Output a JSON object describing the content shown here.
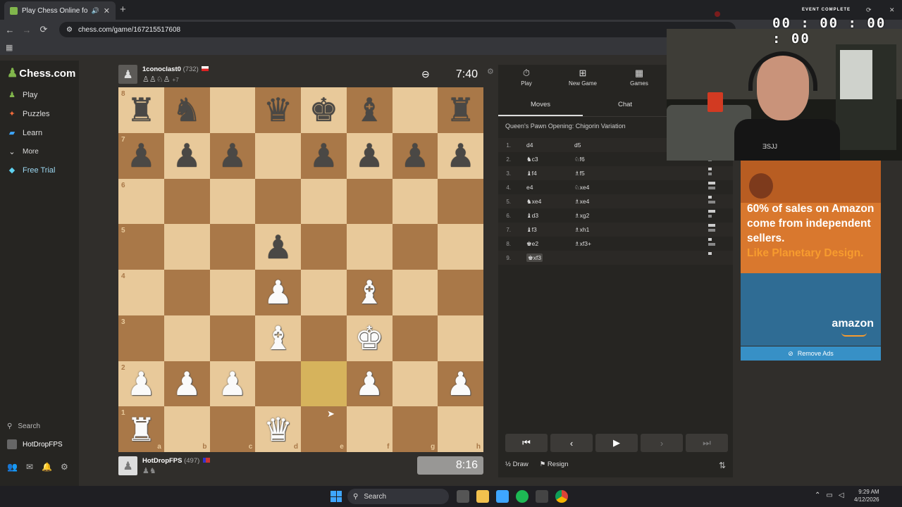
{
  "browser": {
    "tab_title": "Play Chess Online for FREE",
    "tab_close": "✕",
    "tab_audio": "🔊",
    "new_tab": "+",
    "url": "chess.com/game/167215517608",
    "back": "←",
    "forward": "→",
    "reload": "⟳",
    "apps": "▦"
  },
  "sidebar": {
    "logo": "Chess.com",
    "items": [
      {
        "label": "Play",
        "icon": "play-icon"
      },
      {
        "label": "Puzzles",
        "icon": "puzzle-icon"
      },
      {
        "label": "Learn",
        "icon": "learn-icon"
      },
      {
        "label": "More",
        "icon": "chevron-down-icon"
      },
      {
        "label": "Free Trial",
        "icon": "diamond-icon"
      }
    ],
    "search": "Search",
    "user": "HotDropFPS"
  },
  "top_player": {
    "name": "1conoclast0",
    "rating": "(732)",
    "captured": "♙♙♘♙",
    "extra": "+7",
    "clock": "7:40"
  },
  "bottom_player": {
    "name": "HotDropFPS",
    "rating": "(497)",
    "captured": "♟♞",
    "clock": "8:16"
  },
  "board": {
    "ranks": [
      "8",
      "7",
      "6",
      "5",
      "4",
      "3",
      "2",
      "1"
    ],
    "files": [
      "a",
      "b",
      "c",
      "d",
      "e",
      "f",
      "g",
      "h"
    ],
    "position": [
      [
        "r",
        "n",
        "",
        "q",
        "k",
        "b",
        "",
        "r"
      ],
      [
        "p",
        "p",
        "p",
        "",
        "p",
        "p",
        "p",
        "p"
      ],
      [
        "",
        "",
        "",
        "",
        "",
        "",
        "",
        ""
      ],
      [
        "",
        "",
        "",
        "p",
        "",
        "",
        "",
        ""
      ],
      [
        "",
        "",
        "",
        "P",
        "",
        "B",
        "",
        ""
      ],
      [
        "",
        "",
        "",
        "B",
        "",
        "K",
        "",
        ""
      ],
      [
        "P",
        "P",
        "P",
        "",
        "",
        "P",
        "",
        "P"
      ],
      [
        "R",
        "",
        "",
        "Q",
        "",
        "",
        "",
        ""
      ]
    ],
    "highlight": "e2"
  },
  "panel": {
    "tabs": [
      {
        "label": "Play",
        "icon": "stopwatch-icon"
      },
      {
        "label": "New Game",
        "icon": "plus-icon"
      },
      {
        "label": "Games",
        "icon": "board-icon"
      }
    ],
    "subtabs": [
      "Moves",
      "Chat"
    ],
    "opening": "Queen's Pawn Opening: Chigorin Variation",
    "moves": [
      {
        "n": "1.",
        "w": "d4",
        "b": "d5"
      },
      {
        "n": "2.",
        "w": "♞c3",
        "b": "♘f6"
      },
      {
        "n": "3.",
        "w": "♝f4",
        "b": "♗f5"
      },
      {
        "n": "4.",
        "w": "e4",
        "b": "♘xe4"
      },
      {
        "n": "5.",
        "w": "♞xe4",
        "b": "♗xe4"
      },
      {
        "n": "6.",
        "w": "♝d3",
        "b": "♗xg2"
      },
      {
        "n": "7.",
        "w": "♝f3",
        "b": "♗xh1"
      },
      {
        "n": "8.",
        "w": "♚e2",
        "b": "♗xf3+"
      },
      {
        "n": "9.",
        "w": "♚xf3",
        "b": ""
      }
    ],
    "draw": "Draw",
    "resign": "Resign"
  },
  "stream": {
    "event": "EVENT COMPLETE",
    "timer": "00 : 00 : 00 : 00",
    "shirt_text": "ƎSJJ"
  },
  "ad": {
    "line1": "60% of sales on Amazon come from independent sellers.",
    "line2": "Like Planetary Design.",
    "brand": "amazon",
    "remove": "Remove Ads"
  },
  "taskbar": {
    "search": "Search",
    "time": "9:29 AM",
    "date": "4/12/2026"
  }
}
